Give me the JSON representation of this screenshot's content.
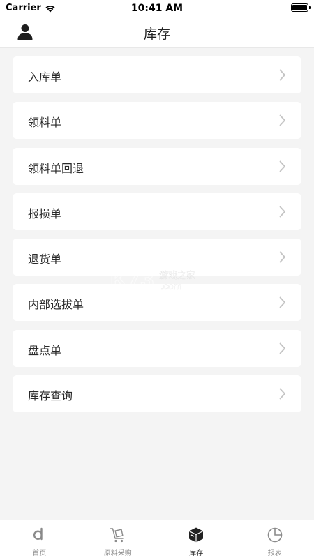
{
  "status_bar": {
    "carrier": "Carrier",
    "time": "10:41 AM"
  },
  "nav": {
    "title": "库存",
    "left_icon": "user-icon"
  },
  "menu": {
    "items": [
      {
        "label": "入库单"
      },
      {
        "label": "领料单"
      },
      {
        "label": "领料单回退"
      },
      {
        "label": "报损单"
      },
      {
        "label": "退货单"
      },
      {
        "label": "内部选拔单"
      },
      {
        "label": "盘点单"
      },
      {
        "label": "库存查询"
      }
    ],
    "chevron_icon": "chevron-right-icon"
  },
  "watermark": {
    "brand": "K73",
    "cn": "游戏之家",
    "domain": ".com"
  },
  "tab_bar": {
    "tabs": [
      {
        "label": "首页",
        "icon": "home-icon",
        "active": false
      },
      {
        "label": "原料采购",
        "icon": "cart-icon",
        "active": false
      },
      {
        "label": "库存",
        "icon": "box-icon",
        "active": true
      },
      {
        "label": "报表",
        "icon": "pie-chart-icon",
        "active": false
      }
    ]
  },
  "colors": {
    "background": "#f4f4f4",
    "card": "#ffffff",
    "text": "#222222",
    "tab_inactive": "#8a8a8a",
    "chevron": "#c4c4c4"
  }
}
